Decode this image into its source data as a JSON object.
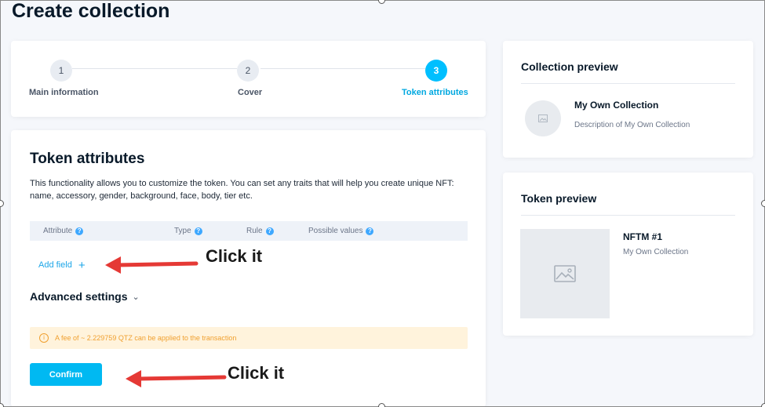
{
  "page": {
    "title": "Create collection"
  },
  "stepper": {
    "steps": [
      {
        "number": "1",
        "label": "Main information"
      },
      {
        "number": "2",
        "label": "Cover"
      },
      {
        "number": "3",
        "label": "Token attributes"
      }
    ]
  },
  "attributes": {
    "title": "Token attributes",
    "description": "This functionality allows you to customize the token. You can set any traits that will help you create unique NFT: name, accessory, gender, background, face, body, tier etc.",
    "columns": [
      "Attribute",
      "Type",
      "Rule",
      "Possible values"
    ],
    "add_field_label": "Add field",
    "add_field_icon": "+",
    "advanced_label": "Advanced settings",
    "fee_text": "A fee of ~ 2.229759 QTZ can be applied to the transaction",
    "confirm_label": "Confirm"
  },
  "collection_preview": {
    "title": "Collection preview",
    "name": "My Own Collection",
    "description": "Description of My Own Collection"
  },
  "token_preview": {
    "title": "Token preview",
    "name": "NFTM #1",
    "collection": "My Own Collection"
  },
  "annotations": {
    "add_field_note": "Click it",
    "confirm_note": "Click it"
  },
  "colors": {
    "accent": "#00bfff",
    "link": "#1ca6e8",
    "warning": "#f0a030",
    "arrow": "#e53935"
  }
}
